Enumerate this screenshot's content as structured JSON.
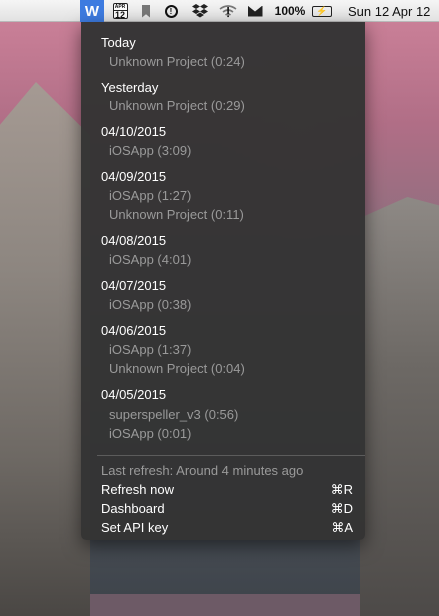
{
  "menubar": {
    "app_icon_letter": "W",
    "calendar_month": "APR",
    "calendar_day": "12",
    "clock_symbol": "!",
    "battery_percent": "100%",
    "battery_symbol": "⚡",
    "datetime": "Sun 12 Apr  12",
    "icons": [
      "w-app-icon",
      "calendar-icon",
      "bookmark-icon",
      "clock-icon",
      "dropbox-icon",
      "wifi-icon",
      "mail-icon",
      "battery-icon"
    ]
  },
  "menu": {
    "groups": [
      {
        "date": "Today",
        "entries": [
          "Unknown Project (0:24)"
        ]
      },
      {
        "date": "Yesterday",
        "entries": [
          "Unknown Project (0:29)"
        ]
      },
      {
        "date": "04/10/2015",
        "entries": [
          "iOSApp (3:09)"
        ]
      },
      {
        "date": "04/09/2015",
        "entries": [
          "iOSApp (1:27)",
          "Unknown Project (0:11)"
        ]
      },
      {
        "date": "04/08/2015",
        "entries": [
          "iOSApp (4:01)"
        ]
      },
      {
        "date": "04/07/2015",
        "entries": [
          "iOSApp (0:38)"
        ]
      },
      {
        "date": "04/06/2015",
        "entries": [
          "iOSApp (1:37)",
          "Unknown Project (0:04)"
        ]
      },
      {
        "date": "04/05/2015",
        "entries": [
          "superspeller_v3 (0:56)",
          "iOSApp (0:01)"
        ]
      }
    ],
    "last_refresh": "Last refresh: Around 4 minutes ago",
    "actions": [
      {
        "label": "Refresh now",
        "shortcut": "⌘R"
      },
      {
        "label": "Dashboard",
        "shortcut": "⌘D"
      },
      {
        "label": "Set API key",
        "shortcut": "⌘A"
      }
    ]
  }
}
